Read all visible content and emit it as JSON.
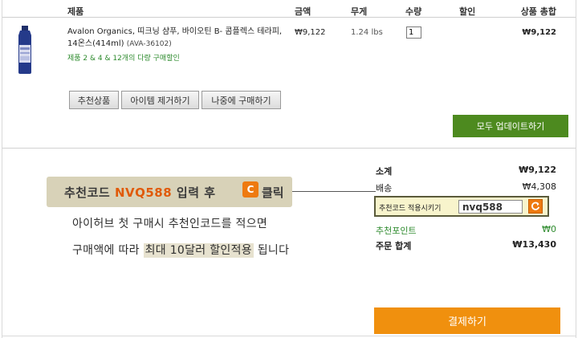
{
  "table_header": {
    "product": "제품",
    "price": "금액",
    "weight": "무게",
    "quantity": "수량",
    "discount": "할인",
    "item_total": "상품 총합"
  },
  "cart_item": {
    "name": "Avalon Organics, 띠크닝 샴푸, 바이오틴 B- 콤플렉스 테라피, 14온스(414ml)",
    "sku": "(AVA-36102)",
    "promo": "제품 2 & 4 & 12개의 다량 구매할인",
    "price": "₩9,122",
    "weight": "1.24 lbs",
    "quantity": "1",
    "total": "₩9,122",
    "image_icon": "shampoo-bottle-icon"
  },
  "item_buttons": {
    "recommend": "추천상품",
    "remove": "아이템 제거하기",
    "save_later": "나중에 구매하기"
  },
  "update_all": "모두 업데이트하기",
  "banner": {
    "line1_prefix": "추천코드 ",
    "code": "NVQ588",
    "line1_suffix": " 입력 후 ",
    "c_icon": "C",
    "click_text": "클릭",
    "line2": "아이허브 첫 구매시 추천인코드를 적으면",
    "line3_a": "구매액에 따라 ",
    "line3_b": "최대 10달러 할인적용",
    "line3_c": " 됩니다"
  },
  "summary": {
    "subtotal_label": "소계",
    "subtotal_value": "₩9,122",
    "shipping_label": "배송",
    "shipping_value": "₩4,308",
    "rec_label": "추천코드 적용시키기",
    "rec_input_value": "nvq588",
    "rec_apply_icon": "refresh-icon",
    "points_label": "추천포인트",
    "points_value": "₩0",
    "total_label": "주문 합계",
    "total_value": "₩13,430"
  },
  "checkout": "결제하기",
  "colors": {
    "green_button": "#4d8a1f",
    "checkout_button": "#f0900e",
    "code_highlight": "#e05a0a",
    "promo_green": "#2e8b2e"
  }
}
